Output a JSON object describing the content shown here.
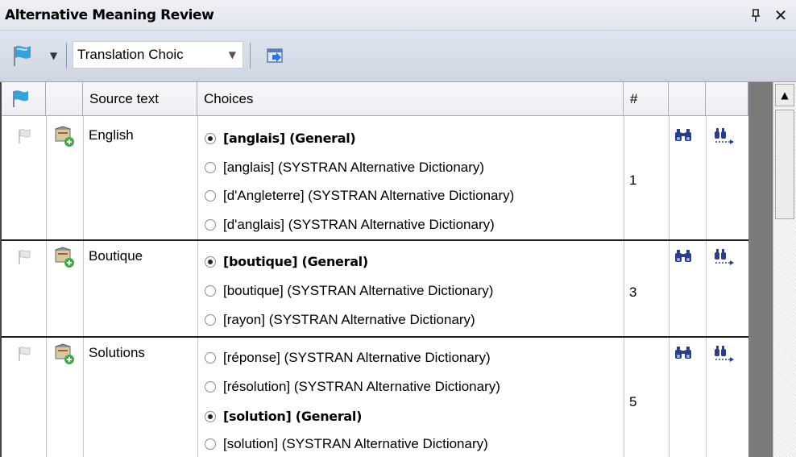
{
  "panel": {
    "title": "Alternative Meaning Review",
    "pin_glyph": "ф",
    "close_glyph": "✕"
  },
  "toolbar": {
    "filter_dropdown_value": "Translation Choic"
  },
  "columns": {
    "source": "Source text",
    "choices": "Choices",
    "count": "#"
  },
  "rows": [
    {
      "source": "English",
      "count": "1",
      "choices": [
        {
          "text": "[anglais] (General)",
          "selected": true
        },
        {
          "text": "[anglais] (SYSTRAN Alternative Dictionary)",
          "selected": false
        },
        {
          "text": "[d'Angleterre] (SYSTRAN Alternative Dictionary)",
          "selected": false
        },
        {
          "text": "[d'anglais] (SYSTRAN Alternative Dictionary)",
          "selected": false
        }
      ]
    },
    {
      "source": "Boutique",
      "count": "3",
      "choices": [
        {
          "text": "[boutique] (General)",
          "selected": true
        },
        {
          "text": "[boutique] (SYSTRAN Alternative Dictionary)",
          "selected": false
        },
        {
          "text": "[rayon] (SYSTRAN Alternative Dictionary)",
          "selected": false
        }
      ]
    },
    {
      "source": "Solutions",
      "count": "5",
      "choices": [
        {
          "text": "[réponse] (SYSTRAN Alternative Dictionary)",
          "selected": false
        },
        {
          "text": "[résolution] (SYSTRAN Alternative Dictionary)",
          "selected": false
        },
        {
          "text": "[solution] (General)",
          "selected": true
        },
        {
          "text": "[solution] (SYSTRAN Alternative Dictionary)",
          "selected": false
        }
      ]
    }
  ],
  "icons": {
    "flag": "flag-icon",
    "add_to_dictionary": "dictionary-add-icon",
    "find": "binoculars-icon",
    "find_next": "find-next-icon",
    "apply": "apply-icon"
  }
}
